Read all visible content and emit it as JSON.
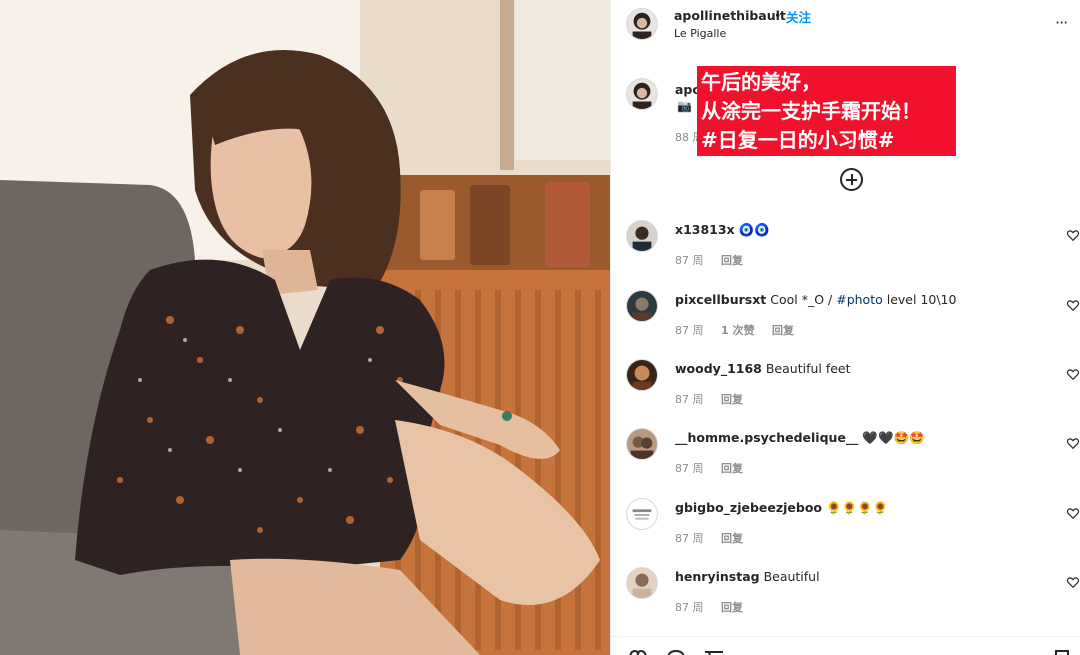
{
  "post": {
    "username": "apollinethibault",
    "separator": "•",
    "follow_label": "关注",
    "location": "Le Pigalle",
    "more_label": "···"
  },
  "caption": {
    "username_fragment": "apo",
    "emoji": "📷",
    "time_fragment": "88 周",
    "overlay_lines": [
      "午后的美好，",
      "从涂完一支护手霜开始！",
      "#日复一日的小习惯#"
    ]
  },
  "comments": [
    {
      "user": "x13813x",
      "text": "🧿🧿",
      "time": "87 周",
      "likes": "",
      "reply": "回复"
    },
    {
      "user": "pixcellbursxt",
      "text_before": "Cool *_O /",
      "hashtag": "#photo",
      "text_after": "level 10\\10",
      "time": "87 周",
      "likes": "1 次赞",
      "reply": "回复"
    },
    {
      "user": "woody_1168",
      "text": "Beautiful feet",
      "time": "87 周",
      "likes": "",
      "reply": "回复"
    },
    {
      "user": "__homme.psychedelique__",
      "text": "🖤🖤🤩🤩",
      "time": "87 周",
      "likes": "",
      "reply": "回复"
    },
    {
      "user": "gbigbo_zjebeezjeboo",
      "text": "🌻🌻🌻🌻",
      "time": "87 周",
      "likes": "",
      "reply": "回复"
    },
    {
      "user": "henryinstag",
      "text": "Beautiful",
      "time": "87 周",
      "likes": "",
      "reply": "回复"
    }
  ],
  "icons": {
    "follow_accent": "#0095f6",
    "banner_color": "#f2112c"
  }
}
